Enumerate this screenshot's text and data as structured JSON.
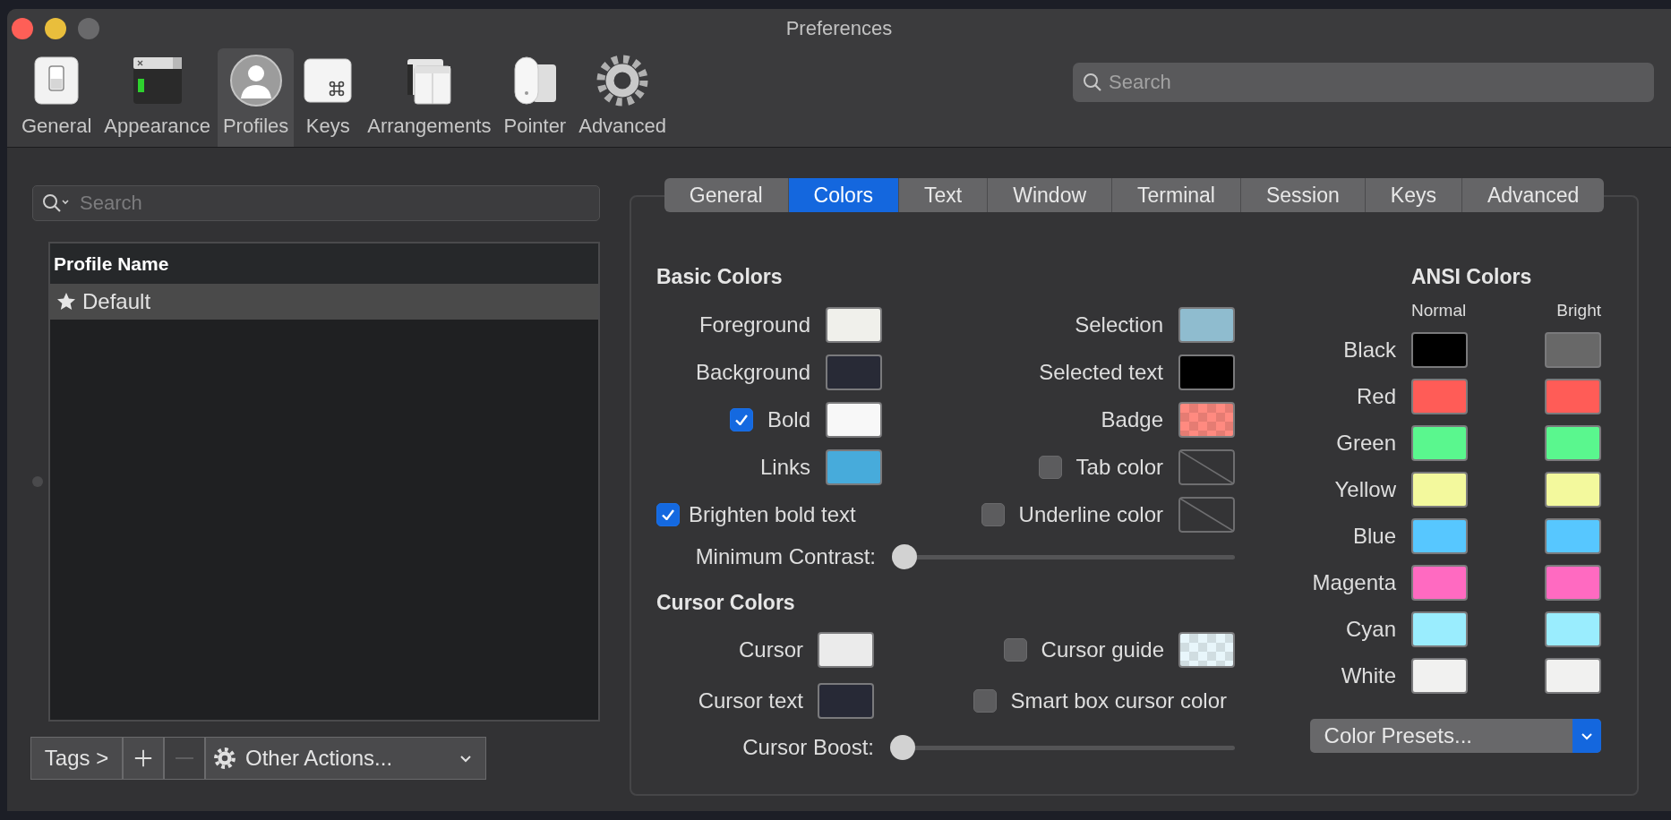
{
  "window": {
    "title": "Preferences"
  },
  "toolbar": {
    "items": [
      {
        "label": "General",
        "kind": "general",
        "selected": false
      },
      {
        "label": "Appearance",
        "kind": "appearance",
        "selected": false
      },
      {
        "label": "Profiles",
        "kind": "profiles",
        "selected": true
      },
      {
        "label": "Keys",
        "kind": "keys",
        "selected": false
      },
      {
        "label": "Arrangements",
        "kind": "arrangements",
        "selected": false
      },
      {
        "label": "Pointer",
        "kind": "pointer",
        "selected": false
      },
      {
        "label": "Advanced",
        "kind": "advanced",
        "selected": false
      }
    ],
    "search": {
      "placeholder": "Search"
    }
  },
  "profiles": {
    "search": {
      "placeholder": "Search"
    },
    "column": "Profile Name",
    "rows": [
      {
        "name": "Default",
        "selected": true
      }
    ],
    "tags_button": "Tags >",
    "remove_disabled": true,
    "actions_button": "Other Actions..."
  },
  "profile_tabs": [
    {
      "label": "General",
      "selected": false
    },
    {
      "label": "Colors",
      "selected": true
    },
    {
      "label": "Text",
      "selected": false
    },
    {
      "label": "Window",
      "selected": false
    },
    {
      "label": "Terminal",
      "selected": false
    },
    {
      "label": "Session",
      "selected": false
    },
    {
      "label": "Keys",
      "selected": false
    },
    {
      "label": "Advanced",
      "selected": false
    }
  ],
  "basic_colors": {
    "title": "Basic Colors",
    "rows": [
      {
        "left": {
          "kind": "color",
          "label": "Foreground",
          "swatch": {
            "kind": "solid",
            "color": "#f0f0eb"
          }
        },
        "right": {
          "kind": "color",
          "label": "Selection",
          "swatch": {
            "kind": "solid",
            "color": "#8fbccf"
          }
        }
      },
      {
        "left": {
          "kind": "color",
          "label": "Background",
          "swatch": {
            "kind": "solid",
            "color": "#282a36"
          }
        },
        "right": {
          "kind": "color",
          "label": "Selected text",
          "swatch": {
            "kind": "solid",
            "color": "#000000"
          }
        }
      },
      {
        "left": {
          "kind": "check_color",
          "label": "Bold",
          "checked": true,
          "swatch": {
            "kind": "solid",
            "color": "#f8f8f8"
          }
        },
        "right": {
          "kind": "color",
          "label": "Badge",
          "swatch": {
            "kind": "checker",
            "color": "#ff8a80"
          }
        }
      },
      {
        "left": {
          "kind": "color",
          "label": "Links",
          "swatch": {
            "kind": "solid",
            "color": "#47abdb"
          }
        },
        "right": {
          "kind": "check_color",
          "label": "Tab color",
          "checked": false,
          "swatch": {
            "kind": "none"
          }
        }
      },
      {
        "left": {
          "kind": "check",
          "label": "Brighten bold text",
          "checked": true
        },
        "right": {
          "kind": "check_color",
          "label": "Underline color",
          "checked": false,
          "swatch": {
            "kind": "none"
          }
        }
      }
    ],
    "slider": {
      "label": "Minimum Contrast:",
      "level": 0
    }
  },
  "cursor_colors": {
    "title": "Cursor Colors",
    "rows": [
      {
        "left": {
          "kind": "color",
          "label": "Cursor",
          "swatch": {
            "kind": "solid",
            "color": "#ebebeb"
          }
        },
        "right": {
          "kind": "check_color",
          "label": "Cursor guide",
          "checked": false,
          "swatch": {
            "kind": "checker",
            "color": "#e8f6fb"
          }
        }
      },
      {
        "left": {
          "kind": "color",
          "label": "Cursor text",
          "swatch": {
            "kind": "solid",
            "color": "#272936"
          }
        },
        "right": {
          "kind": "check",
          "label": "Smart box cursor color",
          "checked": false
        }
      }
    ],
    "slider": {
      "label": "Cursor Boost:",
      "level": 0
    }
  },
  "ansi_colors": {
    "title": "ANSI Colors",
    "columns": [
      "Normal",
      "Bright"
    ],
    "rows": [
      {
        "name": "Black",
        "normal": {
          "color": "#000000"
        },
        "bright": {
          "color": "#686868"
        }
      },
      {
        "name": "Red",
        "normal": {
          "color": "#ff5c57"
        },
        "bright": {
          "color": "#ff5c57"
        }
      },
      {
        "name": "Green",
        "normal": {
          "color": "#5af78e"
        },
        "bright": {
          "color": "#5af78e"
        }
      },
      {
        "name": "Yellow",
        "normal": {
          "color": "#f3f99d"
        },
        "bright": {
          "color": "#f3f99d"
        }
      },
      {
        "name": "Blue",
        "normal": {
          "color": "#57c7ff"
        },
        "bright": {
          "color": "#57c7ff"
        }
      },
      {
        "name": "Magenta",
        "normal": {
          "color": "#ff6ac1"
        },
        "bright": {
          "color": "#ff6ac1"
        }
      },
      {
        "name": "Cyan",
        "normal": {
          "color": "#9aedfe"
        },
        "bright": {
          "color": "#9aedfe"
        }
      },
      {
        "name": "White",
        "normal": {
          "color": "#f1f1f0"
        },
        "bright": {
          "color": "#f1f1f0"
        }
      }
    ],
    "presets_button": "Color Presets..."
  }
}
